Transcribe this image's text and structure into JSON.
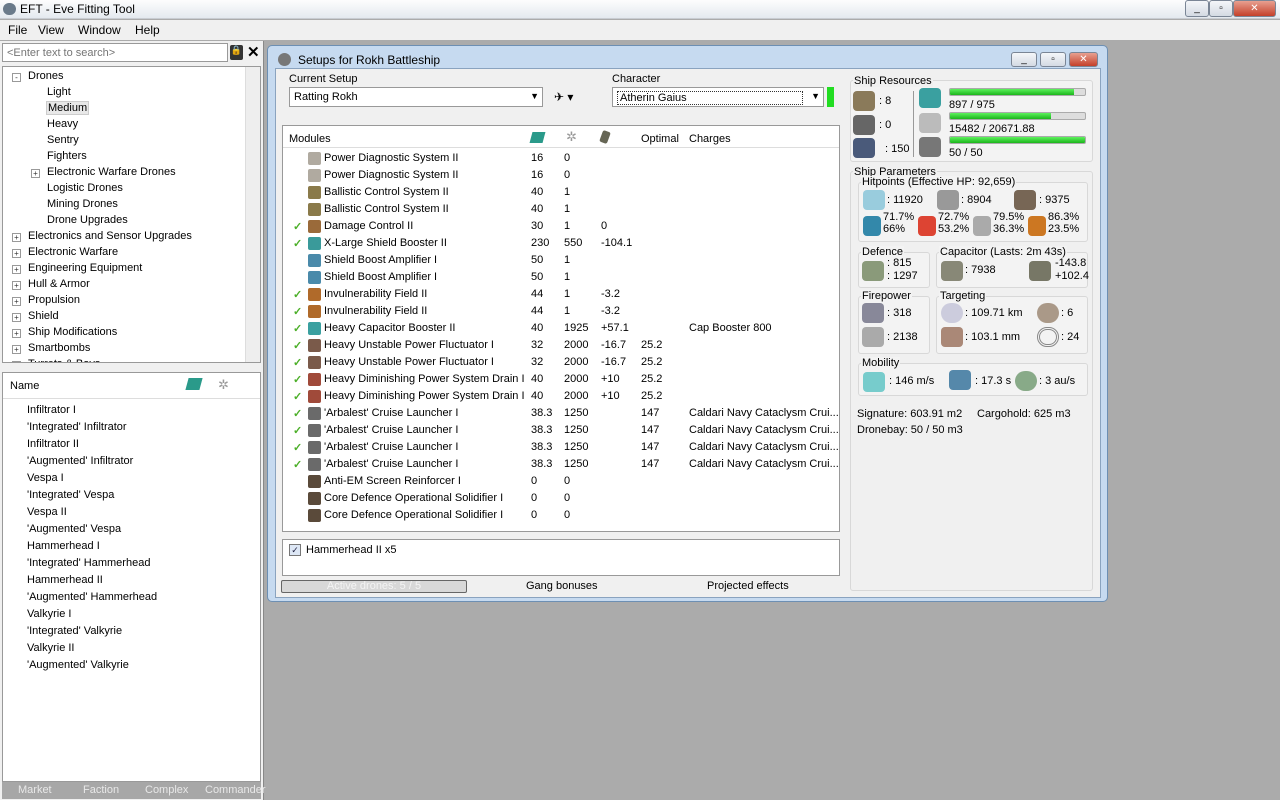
{
  "app": {
    "title": "EFT - Eve Fitting Tool"
  },
  "menu": [
    "File",
    "View",
    "Window",
    "Help"
  ],
  "search": {
    "placeholder": "<Enter text to search>"
  },
  "tree": [
    {
      "label": "Drones",
      "level": 0,
      "sign": "-"
    },
    {
      "label": "Light",
      "level": 1
    },
    {
      "label": "Medium",
      "level": 1,
      "selected": true
    },
    {
      "label": "Heavy",
      "level": 1
    },
    {
      "label": "Sentry",
      "level": 1
    },
    {
      "label": "Fighters",
      "level": 1
    },
    {
      "label": "Electronic Warfare Drones",
      "level": 1,
      "sign": "+"
    },
    {
      "label": "Logistic Drones",
      "level": 1
    },
    {
      "label": "Mining Drones",
      "level": 1
    },
    {
      "label": "Drone Upgrades",
      "level": 1
    },
    {
      "label": "Electronics and Sensor Upgrades",
      "level": 0,
      "sign": "+"
    },
    {
      "label": "Electronic Warfare",
      "level": 0,
      "sign": "+"
    },
    {
      "label": "Engineering Equipment",
      "level": 0,
      "sign": "+"
    },
    {
      "label": "Hull & Armor",
      "level": 0,
      "sign": "+"
    },
    {
      "label": "Propulsion",
      "level": 0,
      "sign": "+"
    },
    {
      "label": "Shield",
      "level": 0,
      "sign": "+"
    },
    {
      "label": "Ship Modifications",
      "level": 0,
      "sign": "+"
    },
    {
      "label": "Smartbombs",
      "level": 0,
      "sign": "+"
    },
    {
      "label": "Turrets & Bays",
      "level": 0,
      "sign": "+"
    }
  ],
  "list": {
    "header": "Name",
    "items": [
      "Infiltrator I",
      "'Integrated' Infiltrator",
      "Infiltrator II",
      "'Augmented' Infiltrator",
      "Vespa I",
      "'Integrated' Vespa",
      "Vespa II",
      "'Augmented' Vespa",
      "Hammerhead I",
      "'Integrated' Hammerhead",
      "Hammerhead II",
      "'Augmented' Hammerhead",
      "Valkyrie I",
      "'Integrated' Valkyrie",
      "Valkyrie II",
      "'Augmented' Valkyrie"
    ]
  },
  "bottom_tabs": [
    "Market",
    "Faction",
    "Complex",
    "Commander"
  ],
  "setup": {
    "title": "Setups for Rokh Battleship",
    "current_setup_label": "Current Setup",
    "current_setup": "Ratting Rokh",
    "character_label": "Character",
    "character": "Atherin Gaius",
    "columns": {
      "modules": "Modules",
      "optimal": "Optimal",
      "charges": "Charges"
    },
    "modules": [
      {
        "name": "Power Diagnostic System II",
        "cpu": "16",
        "pg": "0",
        "cap": "",
        "opt": "",
        "charge": "",
        "active": false,
        "color": "#b0aaa0"
      },
      {
        "name": "Power Diagnostic System II",
        "cpu": "16",
        "pg": "0",
        "cap": "",
        "opt": "",
        "charge": "",
        "active": false,
        "color": "#b0aaa0"
      },
      {
        "name": "Ballistic Control System II",
        "cpu": "40",
        "pg": "1",
        "cap": "",
        "opt": "",
        "charge": "",
        "active": false,
        "color": "#8a7a4a"
      },
      {
        "name": "Ballistic Control System II",
        "cpu": "40",
        "pg": "1",
        "cap": "",
        "opt": "",
        "charge": "",
        "active": false,
        "color": "#8a7a4a"
      },
      {
        "name": "Damage Control II",
        "cpu": "30",
        "pg": "1",
        "cap": "0",
        "opt": "",
        "charge": "",
        "active": true,
        "color": "#9a6a3a"
      },
      {
        "name": "X-Large Shield Booster II",
        "cpu": "230",
        "pg": "550",
        "cap": "-104.1",
        "opt": "",
        "charge": "",
        "active": true,
        "color": "#3a9a9a"
      },
      {
        "name": "Shield Boost Amplifier I",
        "cpu": "50",
        "pg": "1",
        "cap": "",
        "opt": "",
        "charge": "",
        "active": false,
        "color": "#4a8aaa"
      },
      {
        "name": "Shield Boost Amplifier I",
        "cpu": "50",
        "pg": "1",
        "cap": "",
        "opt": "",
        "charge": "",
        "active": false,
        "color": "#4a8aaa"
      },
      {
        "name": "Invulnerability Field II",
        "cpu": "44",
        "pg": "1",
        "cap": "-3.2",
        "opt": "",
        "charge": "",
        "active": true,
        "color": "#b06a2a"
      },
      {
        "name": "Invulnerability Field II",
        "cpu": "44",
        "pg": "1",
        "cap": "-3.2",
        "opt": "",
        "charge": "",
        "active": true,
        "color": "#b06a2a"
      },
      {
        "name": "Heavy Capacitor Booster II",
        "cpu": "40",
        "pg": "1925",
        "cap": "+57.1",
        "opt": "",
        "charge": "Cap Booster 800",
        "active": true,
        "color": "#3aa0a0"
      },
      {
        "name": "Heavy Unstable Power Fluctuator I",
        "cpu": "32",
        "pg": "2000",
        "cap": "-16.7",
        "opt": "25.2",
        "charge": "",
        "active": true,
        "color": "#7a5a4a"
      },
      {
        "name": "Heavy Unstable Power Fluctuator I",
        "cpu": "32",
        "pg": "2000",
        "cap": "-16.7",
        "opt": "25.2",
        "charge": "",
        "active": true,
        "color": "#7a5a4a"
      },
      {
        "name": "Heavy Diminishing Power System Drain I",
        "cpu": "40",
        "pg": "2000",
        "cap": "+10",
        "opt": "25.2",
        "charge": "",
        "active": true,
        "color": "#a04a3a"
      },
      {
        "name": "Heavy Diminishing Power System Drain I",
        "cpu": "40",
        "pg": "2000",
        "cap": "+10",
        "opt": "25.2",
        "charge": "",
        "active": true,
        "color": "#a04a3a"
      },
      {
        "name": "'Arbalest' Cruise Launcher I",
        "cpu": "38.3",
        "pg": "1250",
        "cap": "",
        "opt": "147",
        "charge": "Caldari Navy Cataclysm Crui...",
        "active": true,
        "color": "#6a6a6a"
      },
      {
        "name": "'Arbalest' Cruise Launcher I",
        "cpu": "38.3",
        "pg": "1250",
        "cap": "",
        "opt": "147",
        "charge": "Caldari Navy Cataclysm Crui...",
        "active": true,
        "color": "#6a6a6a"
      },
      {
        "name": "'Arbalest' Cruise Launcher I",
        "cpu": "38.3",
        "pg": "1250",
        "cap": "",
        "opt": "147",
        "charge": "Caldari Navy Cataclysm Crui...",
        "active": true,
        "color": "#6a6a6a"
      },
      {
        "name": "'Arbalest' Cruise Launcher I",
        "cpu": "38.3",
        "pg": "1250",
        "cap": "",
        "opt": "147",
        "charge": "Caldari Navy Cataclysm Crui...",
        "active": true,
        "color": "#6a6a6a"
      },
      {
        "name": "Anti-EM Screen Reinforcer I",
        "cpu": "0",
        "pg": "0",
        "cap": "",
        "opt": "",
        "charge": "",
        "active": false,
        "color": "#5a4a3a"
      },
      {
        "name": "Core Defence Operational Solidifier I",
        "cpu": "0",
        "pg": "0",
        "cap": "",
        "opt": "",
        "charge": "",
        "active": false,
        "color": "#5a4a3a"
      },
      {
        "name": "Core Defence Operational Solidifier I",
        "cpu": "0",
        "pg": "0",
        "cap": "",
        "opt": "",
        "charge": "",
        "active": false,
        "color": "#5a4a3a"
      }
    ],
    "drone": "Hammerhead II x5",
    "tabs": {
      "active_drones": "Active drones: 5 / 5",
      "gang": "Gang bonuses",
      "projected": "Projected effects"
    },
    "resources": {
      "title": "Ship Resources",
      "turrets": ": 8",
      "launchers": ": 0",
      "drone_bandwidth": ": 150",
      "cpu": "897 / 975",
      "cpu_fraction": 0.92,
      "pg": "15482 / 20671.88",
      "pg_fraction": 0.75,
      "drones": "50 / 50",
      "drones_fraction": 1.0
    },
    "params": {
      "title": "Ship Parameters",
      "hp_title": "Hitpoints (Effective HP: 92,659)",
      "shield": ": 11920",
      "armor": ": 8904",
      "structure": ": 9375",
      "resists": [
        [
          "71.7%",
          "66%"
        ],
        [
          "72.7%",
          "53.2%"
        ],
        [
          "79.5%",
          "36.3%"
        ],
        [
          "86.3%",
          "23.5%"
        ]
      ],
      "defence_title": "Defence",
      "defence1": ": 815",
      "defence2": ": 1297",
      "cap_title": "Capacitor (Lasts: 2m 43s)",
      "cap": ": 7938",
      "cap_rate1": "-143.8",
      "cap_rate2": "+102.4",
      "fire_title": "Firepower",
      "dps": ": 318",
      "volley": ": 2138",
      "target_title": "Targeting",
      "range": ": 109.71 km",
      "targets": ": 6",
      "scan": ": 103.1 mm",
      "sensor": ": 24",
      "mob_title": "Mobility",
      "speed": ": 146 m/s",
      "align": ": 17.3 s",
      "warp": ": 3 au/s",
      "signature": "Signature: 603.91 m2",
      "cargo": "Cargohold: 625 m3",
      "dronebay": "Dronebay: 50 / 50 m3"
    }
  }
}
